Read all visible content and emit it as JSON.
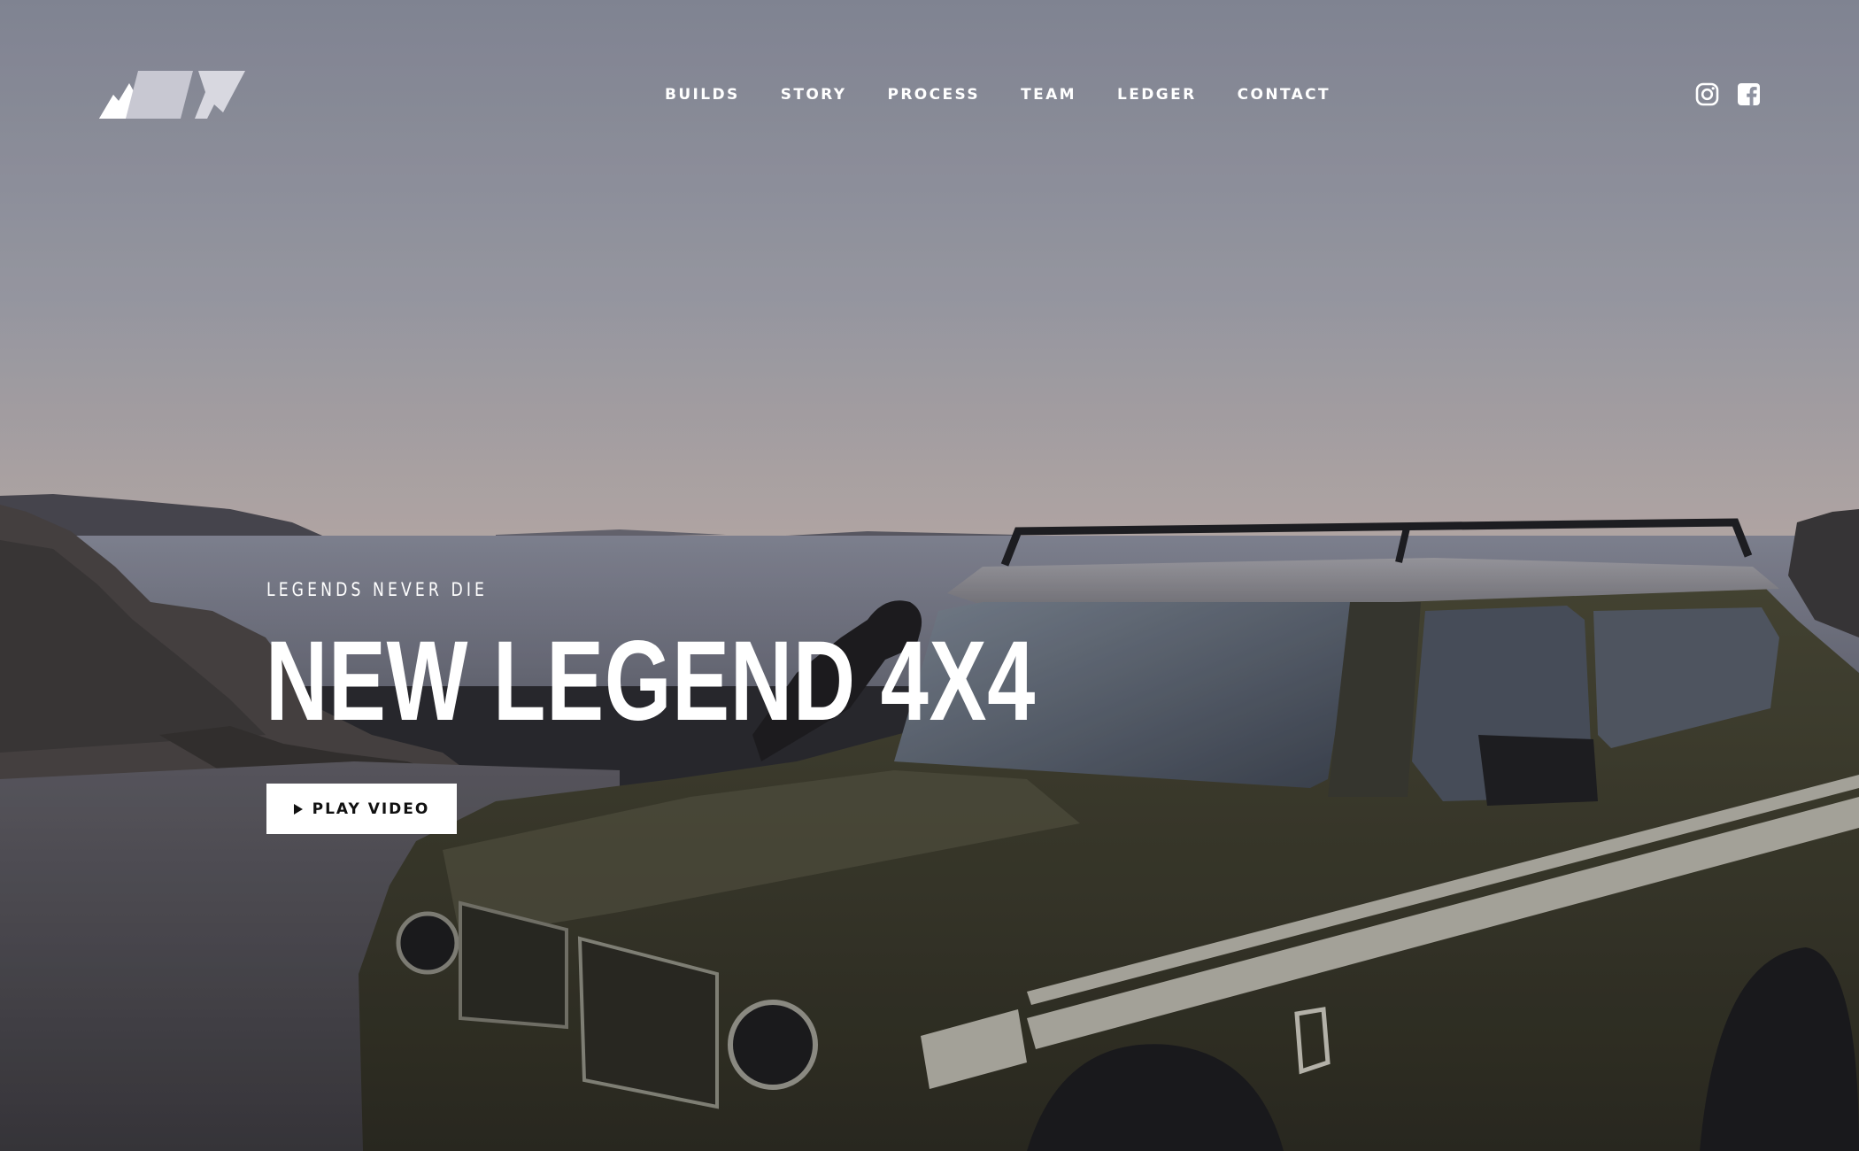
{
  "brand": {
    "logo_icon": "mountain-logo-icon"
  },
  "nav": {
    "items": [
      {
        "label": "BUILDS"
      },
      {
        "label": "STORY"
      },
      {
        "label": "PROCESS"
      },
      {
        "label": "TEAM"
      },
      {
        "label": "LEDGER"
      },
      {
        "label": "CONTACT"
      }
    ]
  },
  "social": {
    "instagram_icon": "instagram-icon",
    "facebook_icon": "facebook-icon"
  },
  "hero": {
    "eyebrow": "LEGENDS NEVER DIE",
    "headline": "NEW LEGEND 4X4",
    "cta_label": "PLAY VIDEO",
    "cta_icon": "play-icon"
  },
  "colors": {
    "text": "#ffffff",
    "button_bg": "#ffffff",
    "button_text": "#111111",
    "sky_top": "#8f93a2",
    "sky_horizon": "#c3b7b6",
    "truck_body": "#3c3b2a"
  }
}
